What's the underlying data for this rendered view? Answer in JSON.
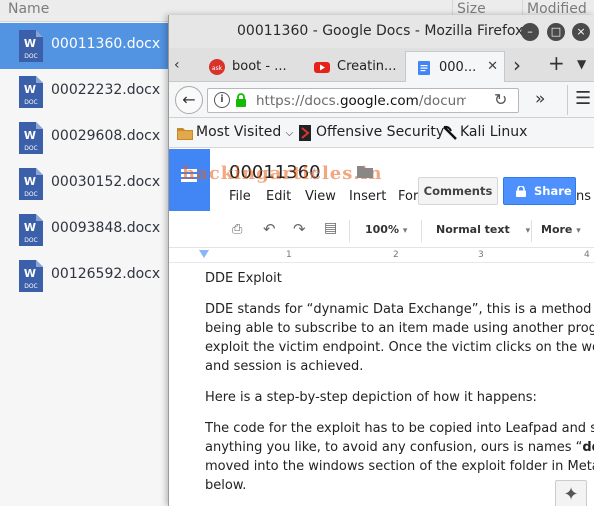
{
  "file_manager": {
    "columns": {
      "name": "Name",
      "size": "Size",
      "modified": "Modified"
    },
    "files": [
      {
        "name": "00011360.docx",
        "selected": true
      },
      {
        "name": "00022232.docx",
        "selected": false
      },
      {
        "name": "00029608.docx",
        "selected": false
      },
      {
        "name": "00030152.docx",
        "selected": false
      },
      {
        "name": "00093848.docx",
        "selected": false
      },
      {
        "name": "00126592.docx",
        "selected": false
      }
    ],
    "file_icon": "word-doc-icon",
    "file_icon_label": "DOC"
  },
  "browser": {
    "window_title": "00011360 - Google Docs - Mozilla Firefox",
    "window_buttons": [
      "minimize-icon",
      "maximize-icon",
      "close-icon"
    ],
    "tabs": [
      {
        "label": "boot - ...",
        "icon": "ask-icon",
        "active": false
      },
      {
        "label": "Creatin...",
        "icon": "youtube-icon",
        "active": false
      },
      {
        "label": "000...",
        "icon": "google-docs-icon",
        "active": true
      }
    ],
    "url_prefix": "https://docs.",
    "url_domain": "google.com",
    "url_suffix": "/docume",
    "bookmarks": [
      {
        "label": "Most Visited",
        "icon": "folder-icon"
      },
      {
        "label": "Offensive Security",
        "icon": "offsec-icon"
      },
      {
        "label": "Kali Linux",
        "icon": "kali-icon"
      }
    ],
    "colors": {
      "selection": "#5294e2",
      "docs_blue": "#4285f4",
      "share_blue": "#4d90fe"
    }
  },
  "docs": {
    "title": "00011360",
    "watermark": "hackingarticles.in",
    "menus": [
      "File",
      "Edit",
      "View",
      "Insert",
      "For"
    ],
    "menu_overflow": "ons",
    "comments_label": "Comments",
    "share_label": "Share",
    "zoom": "100%",
    "style": "Normal text",
    "more": "More",
    "ruler_marks": [
      "1",
      "2",
      "3",
      "4"
    ],
    "paragraphs": {
      "heading": "DDE Exploit",
      "p1": [
        "DDE stands for “dynamic Data Exchange”, this is a method used b",
        "being able to subscribe to an item made using another program. T",
        "exploit the victim endpoint. Once the victim clicks on the word file",
        "and session is achieved."
      ],
      "p2": "Here is a step-by-step depiction of how it happens:",
      "p3_line1": "The code for the exploit has to be copied into Leafpad and saved w",
      "p3_line2_a": "anything you like, to avoid any confusion, ours is names “",
      "p3_line2_b": "dde_de",
      "p3_line3": "moved into the windows section of the exploit folder in Metasplo",
      "p3_line4": "below."
    }
  }
}
